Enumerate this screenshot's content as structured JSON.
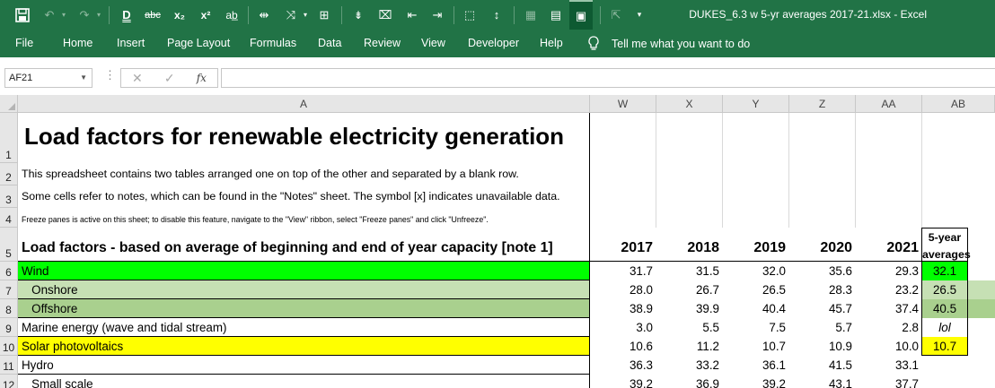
{
  "window": {
    "title": "DUKES_6.3 w 5-yr averages 2017-21.xlsx  -  Excel"
  },
  "ribbon": {
    "menus": [
      "File",
      "Home",
      "Insert",
      "Page Layout",
      "Formulas",
      "Data",
      "Review",
      "View",
      "Developer",
      "Help"
    ],
    "tell_me": "Tell me what you want to do"
  },
  "formula_bar": {
    "name_box": "AF21",
    "fx": "fx",
    "content": ""
  },
  "columns": [
    "A",
    "W",
    "X",
    "Y",
    "Z",
    "AA",
    "AB"
  ],
  "rows": [
    "1",
    "2",
    "3",
    "4",
    "5",
    "6",
    "7",
    "8",
    "9",
    "10",
    "11",
    "12"
  ],
  "sheet": {
    "title": "Load factors for renewable electricity generation",
    "line2": "This spreadsheet contains two tables arranged one on top of the other and separated by a blank row.",
    "line3": "Some cells refer to notes, which can be found in the \"Notes\" sheet. The symbol [x] indicates unavailable data.",
    "line4": "Freeze panes is active on this sheet; to disable this feature, navigate to the \"View\" ribbon, select \"Freeze panes\" and click \"Unfreeze\".",
    "table_header": "Load factors - based on average of beginning and end of year capacity [note 1]",
    "years": [
      "2017",
      "2018",
      "2019",
      "2020",
      "2021"
    ],
    "avg_header_1": "5-year",
    "avg_header_2": "averages",
    "data_rows": [
      {
        "label": "Wind",
        "values": [
          "31.7",
          "31.5",
          "32.0",
          "35.6",
          "29.3"
        ],
        "avg": "32.1"
      },
      {
        "label": "   Onshore",
        "values": [
          "28.0",
          "26.7",
          "26.5",
          "28.3",
          "23.2"
        ],
        "avg": "26.5"
      },
      {
        "label": "   Offshore",
        "values": [
          "38.9",
          "39.9",
          "40.4",
          "45.7",
          "37.4"
        ],
        "avg": "40.5"
      },
      {
        "label": "Marine energy (wave and tidal stream)",
        "values": [
          "3.0",
          "5.5",
          "7.5",
          "5.7",
          "2.8"
        ],
        "avg": "lol"
      },
      {
        "label": "Solar photovoltaics",
        "values": [
          "10.6",
          "11.2",
          "10.7",
          "10.9",
          "10.0"
        ],
        "avg": "10.7"
      },
      {
        "label": "Hydro",
        "values": [
          "36.3",
          "33.2",
          "36.1",
          "41.5",
          "33.1"
        ],
        "avg": ""
      },
      {
        "label": "   Small scale",
        "values": [
          "39.2",
          "36.9",
          "39.2",
          "43.1",
          "37.7"
        ],
        "avg": ""
      }
    ]
  },
  "colors": {
    "excel_green": "#217346",
    "wind_fill": "#00ff00",
    "onshore_fill": "#c6e0b4",
    "offshore_fill": "#a9d08e",
    "solar_fill": "#ffff00"
  }
}
